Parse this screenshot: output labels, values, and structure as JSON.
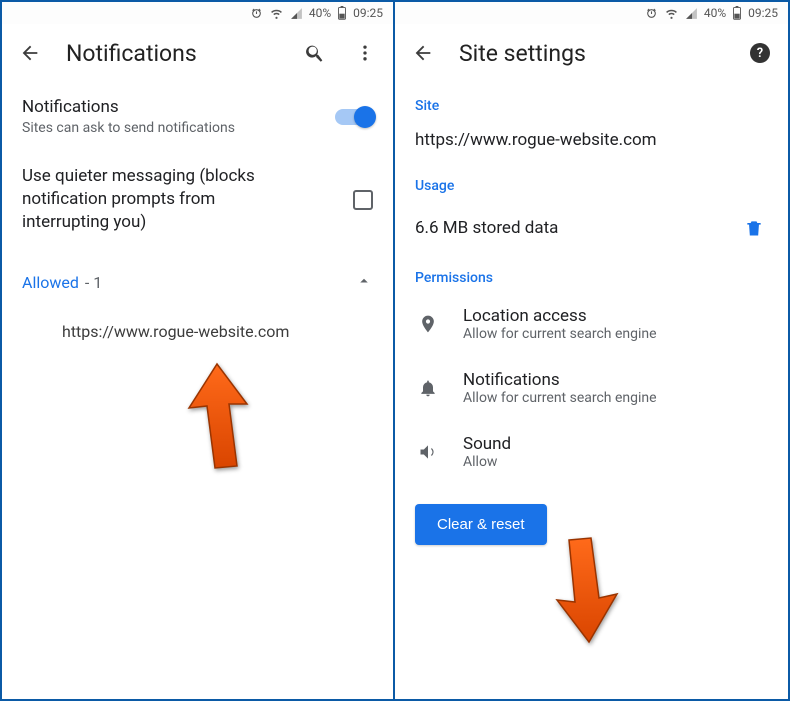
{
  "status": {
    "battery_pct": "40%",
    "time": "09:25"
  },
  "left": {
    "title": "Notifications",
    "notif_heading": "Notifications",
    "notif_sub": "Sites can ask to send notifications",
    "quieter": "Use quieter messaging (blocks notification prompts from interrupting you)",
    "allowed_label": "Allowed",
    "allowed_count": "- 1",
    "site_url": "https://www.rogue-website.com"
  },
  "right": {
    "title": "Site settings",
    "section_site": "Site",
    "site_url": "https://www.rogue-website.com",
    "section_usage": "Usage",
    "usage_value": "6.6 MB stored data",
    "section_permissions": "Permissions",
    "perm_location_title": "Location access",
    "perm_location_sub": "Allow for current search engine",
    "perm_notif_title": "Notifications",
    "perm_notif_sub": "Allow for current search engine",
    "perm_sound_title": "Sound",
    "perm_sound_sub": "Allow",
    "cta": "Clear & reset"
  }
}
